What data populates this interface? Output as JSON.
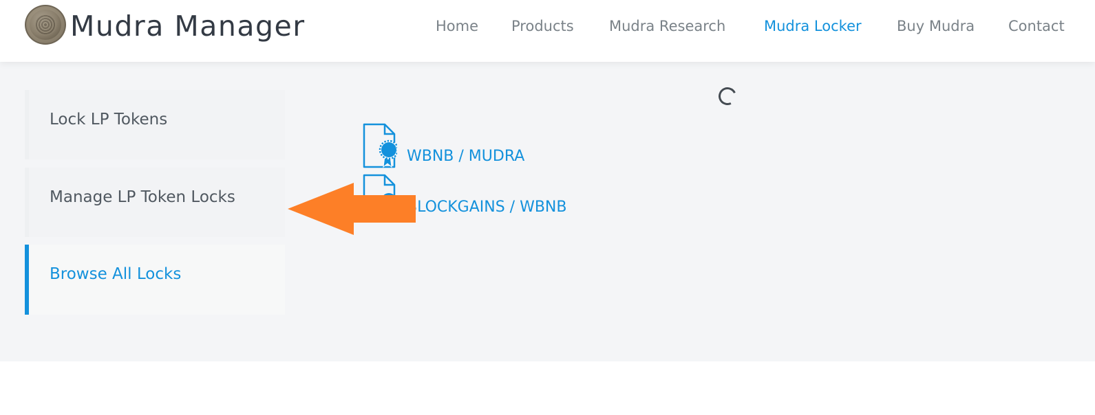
{
  "header": {
    "brand": "Mudra Manager",
    "nav": [
      {
        "label": "Home",
        "active": false
      },
      {
        "label": "Products",
        "active": false
      },
      {
        "label": "Mudra Research",
        "active": false
      },
      {
        "label": "Mudra Locker",
        "active": true
      },
      {
        "label": "Buy Mudra",
        "active": false
      },
      {
        "label": "Contact",
        "active": false
      }
    ]
  },
  "sidebar": {
    "items": [
      {
        "label": "Lock LP Tokens",
        "active": false
      },
      {
        "label": "Manage LP Token Locks",
        "active": false
      },
      {
        "label": "Browse All Locks",
        "active": true
      }
    ]
  },
  "locks": [
    {
      "pair": "WBNB / MUDRA",
      "icon": "certificate-icon"
    },
    {
      "pair": "BLOCKGAINS / WBNB",
      "icon": "certificate-icon"
    }
  ],
  "colors": {
    "accent": "#1391dc",
    "annotation_arrow": "#fd7f27",
    "main_bg": "#f4f5f7"
  }
}
